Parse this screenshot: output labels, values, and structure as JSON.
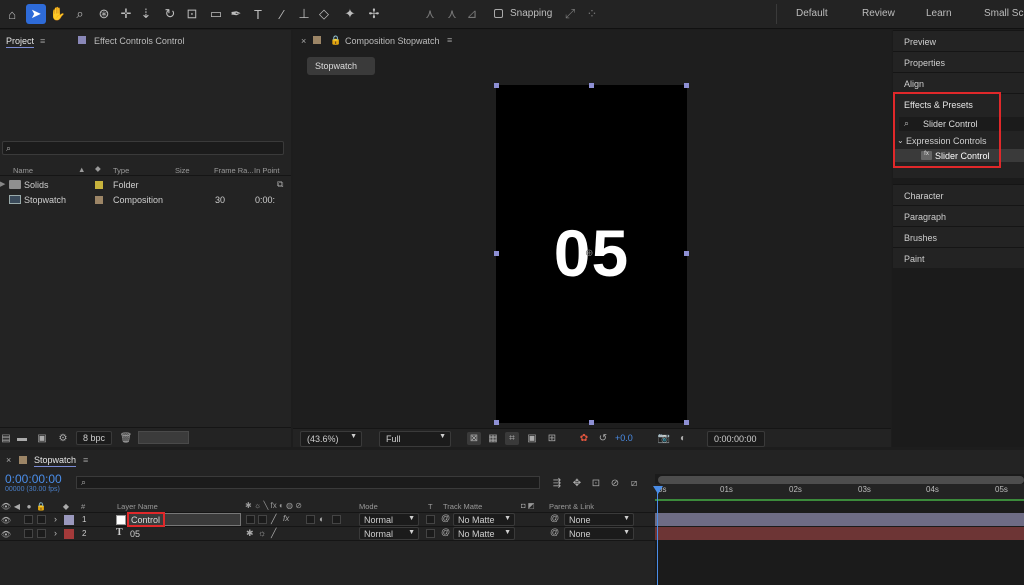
{
  "toolbar": {
    "snapping_label": "Snapping",
    "workspaces": [
      "Default",
      "Review",
      "Learn",
      "Small Scre"
    ]
  },
  "project_panel": {
    "tab_project": "Project",
    "tab_effect_controls": "Effect Controls Control",
    "columns": [
      "Name",
      "Type",
      "Size",
      "Frame Ra...",
      "In Point"
    ],
    "items": [
      {
        "name": "Solids",
        "type": "Folder",
        "frame_rate": "",
        "in_point": "",
        "label_color": "#c7b33c"
      },
      {
        "name": "Stopwatch",
        "type": "Composition",
        "frame_rate": "30",
        "in_point": "0:00:",
        "label_color": "#9c8566"
      }
    ],
    "bpc_label": "8 bpc"
  },
  "comp_panel": {
    "tab_label": "Composition Stopwatch",
    "comp_button": "Stopwatch",
    "canvas_text": "05",
    "zoom_value": "(43.6%)",
    "resolution_value": "Full",
    "exposure_value": "+0.0",
    "timecode": "0:00:00:00"
  },
  "right_panel": {
    "items_top": [
      "Preview",
      "Properties",
      "Align"
    ],
    "effects_title": "Effects & Presets",
    "search_value": "Slider Control",
    "category": "Expression Controls",
    "result": "Slider Control",
    "items_bottom": [
      "Character",
      "Paragraph",
      "Brushes",
      "Paint"
    ]
  },
  "timeline": {
    "tab_label": "Stopwatch",
    "timecode": "0:00:00:00",
    "fps_label": "00000 (30.00 fps)",
    "col_layer_name": "Layer Name",
    "col_hash": "#",
    "col_mode": "Mode",
    "col_t": "T",
    "col_track_matte": "Track Matte",
    "col_parent": "Parent & Link",
    "ruler": [
      "0s",
      "01s",
      "02s",
      "03s",
      "04s",
      "05s"
    ],
    "layers": [
      {
        "num": "1",
        "name": "Control",
        "mode": "Normal",
        "matte": "No Matte",
        "parent": "None",
        "label_color": "#9a98bd",
        "bar_color": "#6e6c85"
      },
      {
        "num": "2",
        "name": "05",
        "mode": "Normal",
        "matte": "No Matte",
        "parent": "None",
        "label_color": "#a33a3a",
        "bar_color": "#6d3535"
      }
    ]
  },
  "colors": {
    "accent": "#2e6bd8",
    "highlight_box": "#e0282a",
    "timecode_blue": "#4a8de8"
  }
}
